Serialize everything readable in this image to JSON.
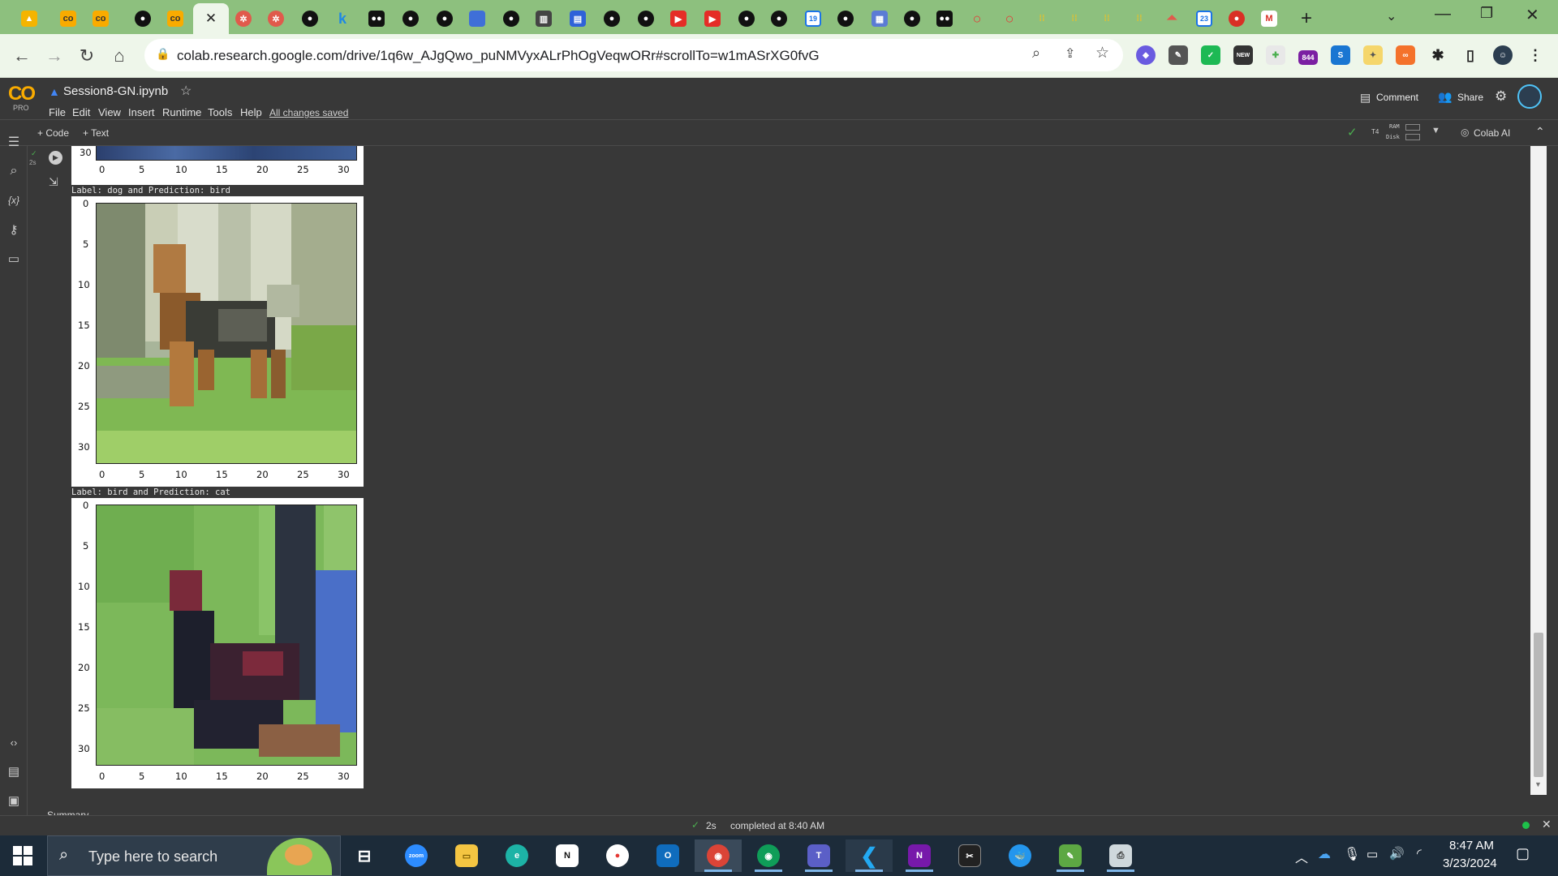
{
  "browser": {
    "url": "colab.research.google.com/drive/1q6w_AJgQwo_puNMVyxALrPhOgVeqwORr#scrollTo=w1mASrXG0fvG",
    "badge_844": "844",
    "calendar_day": "19",
    "calendar_day2": "23",
    "new_badge": "NEW"
  },
  "colab": {
    "logo": "CO",
    "pro": "PRO",
    "notebook_title": "Session8-GN.ipynb",
    "menu": [
      "File",
      "Edit",
      "View",
      "Insert",
      "Runtime",
      "Tools",
      "Help"
    ],
    "saved_status": "All changes saved",
    "comment": "Comment",
    "share": "Share",
    "add_code": "+ Code",
    "add_text": "+ Text",
    "runtime": "T4",
    "ram": "RAM",
    "disk": "Disk",
    "colab_ai": "Colab AI"
  },
  "cell": {
    "exec_status": "2s",
    "bottom_text": "Summary"
  },
  "plots": {
    "ticks": [
      "0",
      "5",
      "10",
      "15",
      "20",
      "25",
      "30"
    ],
    "top_partial_ytick": "30",
    "captions": [
      "Label: dog and Prediction: bird",
      "Label: bird and Prediction: cat"
    ]
  },
  "statusbar": {
    "time": "2s",
    "completed": "completed at 8:40 AM"
  },
  "taskbar": {
    "search_placeholder": "Type here to search",
    "zoom_label": "zoom",
    "clock_time": "8:47 AM",
    "clock_date": "3/23/2024"
  }
}
